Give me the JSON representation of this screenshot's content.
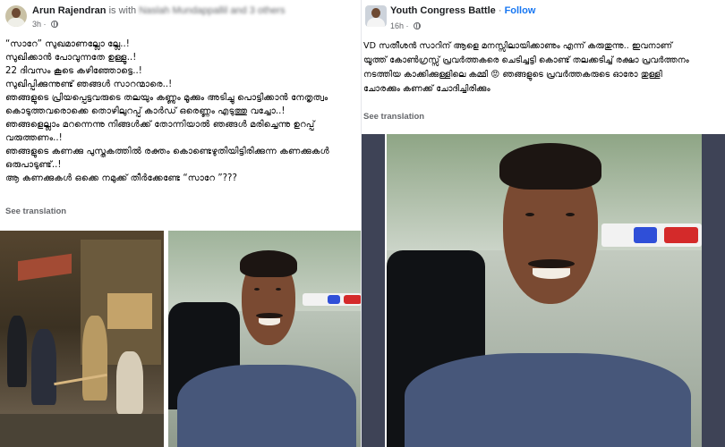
{
  "left_post": {
    "author": "Arun Rajendran",
    "author_suffix": "is with",
    "tagged_blurred": "Naslah Mundappallil and 3 others",
    "time": "3h",
    "lines": [
      "“സാറേ” സുഖമാണല്ലോ ല്ലേ..!",
      "സുഖിക്കാൻ പോവുന്നതേ ഉള്ളൂ..!",
      "22 ദിവസം കൂടെ കഴിഞ്ഞോട്ടെ..!",
      "സുഖിപ്പിക്കുന്നുണ്ട് ഞങ്ങൾ സാറന്മാരെ..!",
      "ഞങ്ങളുടെ പ്രിയപ്പെട്ടവരുടെ തലയും കണ്ണും മൂക്കും അടിച്ചു പൊട്ടിക്കാൻ നേതൃത്വം",
      "കൊടുത്തവരൊക്കെ തൊഴിലുറപ്പ് കാർഡ് ഒരെണ്ണം എടുത്തു വച്ചോ..!",
      "ഞങ്ങളെല്ലാം മറന്നെന്നു നിങ്ങൾക്ക് തോന്നിയാൽ ഞങ്ങൾ മരിച്ചെന്നു ഉറപ്പ്",
      "വരുത്തണം..!",
      "ഞങ്ങളുടെ കണക്കു പുസ്തകത്തിൽ രക്തം കൊണ്ടെഴുതിയിട്ടിരിക്കുന്ന കണക്കുകൾ",
      "ഒരുപാടുണ്ട്..!",
      "ആ കണക്കുകൾ ഒക്കെ നമുക്ക് തീർക്കേണ്ടേ “സാറേ ”???"
    ],
    "see_translation": "See translation"
  },
  "right_post": {
    "author": "Youth Congress Battle",
    "follow": "Follow",
    "time": "16h",
    "lines": [
      "VD സതീശൻ സാറിന് ആളെ മനസ്സിലായിക്കാണും എന്ന് കരുതുന്നു.. ഇവനാണ്",
      "യൂത്ത് കോൺഗ്രസ്സ് പ്രവർത്തകരെ ചെടിച്ചട്ടി കൊണ്ട് തലക്കടിച്ച് രക്ഷാ പ്രവർത്തനം",
      "നടത്തിയ കാക്കിക്കുള്ളിലെ കമ്മി 😡 ഞങ്ങളുടെ പ്രവർത്തകരുടെ ഓരോ തുള്ളി",
      "ചോരക്കും കണക്ക് ചോദിച്ചിരിക്കും"
    ],
    "see_translation": "See translation"
  },
  "colors": {
    "link_blue": "#1877f2",
    "meta_gray": "#65676b",
    "text_black": "#050505",
    "shirt_blue": "#47577a"
  }
}
